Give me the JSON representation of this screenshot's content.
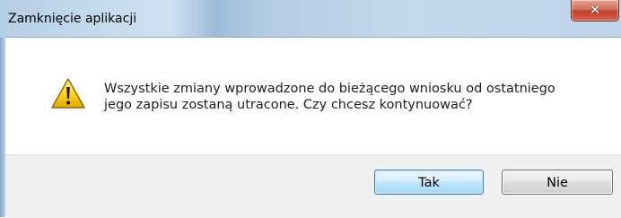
{
  "window": {
    "title": "Zamknięcie aplikacji",
    "close_icon": "close-icon"
  },
  "message": {
    "icon": "warning-icon",
    "line1": "Wszystkie zmiany wprowadzone do bieżącego wniosku od ostatniego",
    "line2": "jego zapisu zostaną utracone. Czy chcesz kontynuować?"
  },
  "buttons": {
    "yes_label": "Tak",
    "no_label": "Nie"
  },
  "colors": {
    "titlebar": "#c4d9ec",
    "close_button": "#c7452e",
    "footer": "#f0f0f0",
    "default_button_border": "#3c7fb1",
    "warning_yellow": "#f5c400"
  }
}
